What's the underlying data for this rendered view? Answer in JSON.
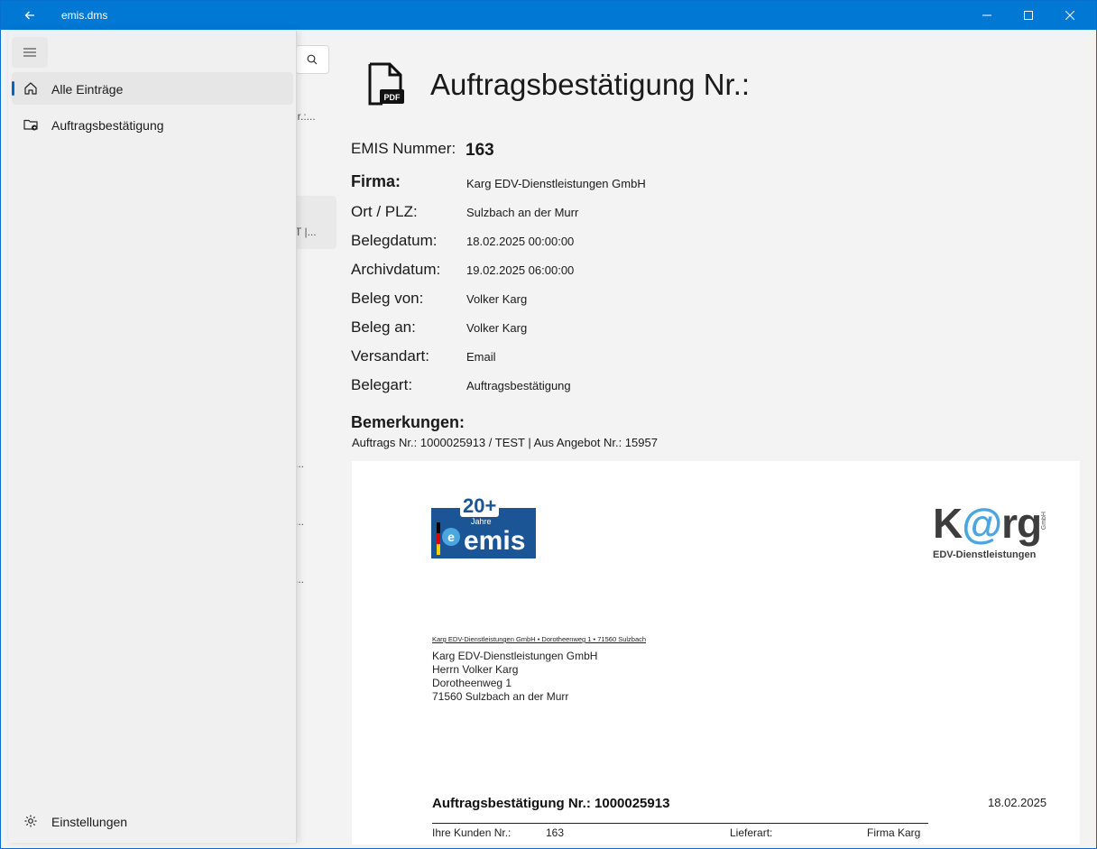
{
  "window": {
    "title": "emis.dms"
  },
  "nav": {
    "items": [
      {
        "label": "Alle Einträge"
      },
      {
        "label": "Auftragsbestätigung"
      }
    ],
    "settings_label": "Einstellungen"
  },
  "list_fragments": [
    "lr.:...",
    "T |...",
    "...",
    "...",
    "..."
  ],
  "detail": {
    "title": "Auftragsbestätigung Nr.:",
    "emis_label": "EMIS Nummer:",
    "emis_value": "163",
    "fields": [
      {
        "label": "Firma:",
        "value": "Karg EDV-Dienstleistungen GmbH"
      },
      {
        "label": "Ort / PLZ:",
        "value": "Sulzbach an der Murr"
      },
      {
        "label": "Belegdatum:",
        "value": "18.02.2025 00:00:00"
      },
      {
        "label": "Archivdatum:",
        "value": "19.02.2025 06:00:00"
      },
      {
        "label": "Beleg von:",
        "value": "Volker Karg"
      },
      {
        "label": "Beleg an:",
        "value": "Volker Karg"
      },
      {
        "label": "Versandart:",
        "value": "Email"
      },
      {
        "label": "Belegart:",
        "value": "Auftragsbestätigung"
      }
    ],
    "remarks_label": "Bemerkungen:",
    "remarks_value": "Auftrags Nr.: 1000025913 / TEST | Aus Angebot Nr.: 15957"
  },
  "document": {
    "emis_logo": {
      "badge": "20+",
      "jahre": "Jahre",
      "word": "emis"
    },
    "karg_logo": {
      "word_pre": "K",
      "word_at": "@",
      "word_post": "rg",
      "gmbh": "GmbH",
      "subtitle": "EDV-Dienstleistungen"
    },
    "sender_line": "Karg EDV-Dienstleistungen GmbH • Dorotheenweg 1 • 71560 Sulzbach",
    "address": [
      "Karg EDV-Dienstleistungen GmbH",
      "Herrn Volker Karg",
      "Dorotheenweg 1",
      "71560 Sulzbach an der Murr"
    ],
    "heading": "Auftragsbestätigung Nr.: 1000025913",
    "date": "18.02.2025",
    "row": {
      "kunden_label": "Ihre Kunden Nr.:",
      "kunden_value": "163",
      "lieferart_label": "Lieferart:",
      "lieferart_value": "Firma Karg"
    }
  }
}
